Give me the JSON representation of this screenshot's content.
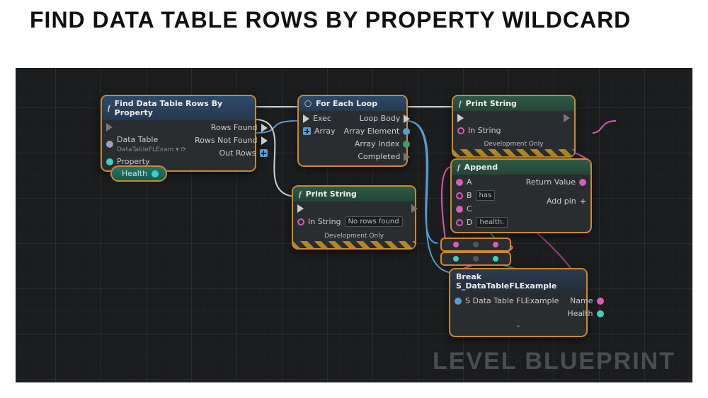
{
  "title": "FIND DATA TABLE ROWS BY PROPERTY WILDCARD",
  "watermark": "LEVEL BLUEPRINT",
  "nodes": {
    "find": {
      "title": "Find Data Table Rows By Property",
      "in": {
        "data_table_label": "Data Table",
        "data_table_value": "DataTableFLExam",
        "property": "Property"
      },
      "out": {
        "rows_found": "Rows Found",
        "rows_not_found": "Rows Not Found",
        "out_rows": "Out Rows"
      }
    },
    "health_badge": "Health",
    "foreach": {
      "title": "For Each Loop",
      "in": {
        "exec": "Exec",
        "array": "Array"
      },
      "out": {
        "loop_body": "Loop Body",
        "element": "Array Element",
        "index": "Array Index",
        "completed": "Completed"
      }
    },
    "printstring1": {
      "title": "Print String",
      "in_string": "In String",
      "dev_only": "Development Only"
    },
    "printstring2": {
      "title": "Print String",
      "in_string": "In String",
      "in_string_value": "No rows found",
      "dev_only": "Development Only"
    },
    "append": {
      "title": "Append",
      "a": "A",
      "b": "B",
      "b_val": "has",
      "c": "C",
      "d": "D",
      "d_val": "health.",
      "rv": "Return Value",
      "addpin": "Add pin"
    },
    "break": {
      "title": "Break S_DataTableFLExample",
      "in": "S Data Table FLExample",
      "name": "Name",
      "health": "Health"
    }
  }
}
